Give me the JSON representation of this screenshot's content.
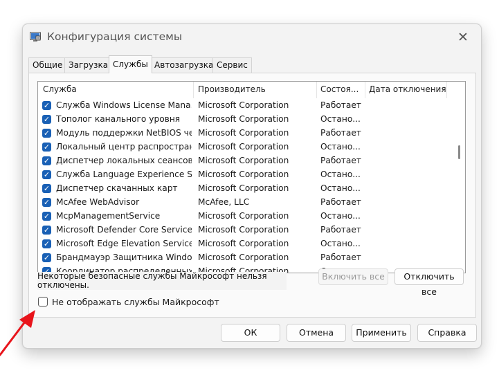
{
  "window": {
    "title": "Конфигурация системы",
    "close_icon": "close-icon"
  },
  "tabs": [
    {
      "label": "Общие"
    },
    {
      "label": "Загрузка"
    },
    {
      "label": "Службы"
    },
    {
      "label": "Автозагрузка"
    },
    {
      "label": "Сервис"
    }
  ],
  "active_tab": "Службы",
  "columns": {
    "service": "Служба",
    "manufacturer": "Производитель",
    "status": "Состоя...",
    "disabled_date": "Дата отключения"
  },
  "services": [
    {
      "name": "Служба Windows License Mana...",
      "manufacturer": "Microsoft Corporation",
      "status": "Работает",
      "checked": true
    },
    {
      "name": "Тополог канального уровня",
      "manufacturer": "Microsoft Corporation",
      "status": "Остано...",
      "checked": true
    },
    {
      "name": "Модуль поддержки NetBIOS че...",
      "manufacturer": "Microsoft Corporation",
      "status": "Работает",
      "checked": true
    },
    {
      "name": "Локальный центр распростран...",
      "manufacturer": "Microsoft Corporation",
      "status": "Остано...",
      "checked": true
    },
    {
      "name": "Диспетчер локальных сеансов",
      "manufacturer": "Microsoft Corporation",
      "status": "Работает",
      "checked": true
    },
    {
      "name": "Служба Language Experience S...",
      "manufacturer": "Microsoft Corporation",
      "status": "Остано...",
      "checked": true
    },
    {
      "name": "Диспетчер скачанных карт",
      "manufacturer": "Microsoft Corporation",
      "status": "Остано...",
      "checked": true
    },
    {
      "name": "McAfee WebAdvisor",
      "manufacturer": "McAfee, LLC",
      "status": "Работает",
      "checked": true
    },
    {
      "name": "McpManagementService",
      "manufacturer": "Microsoft Corporation",
      "status": "Остано...",
      "checked": true
    },
    {
      "name": "Microsoft Defender Core Service",
      "manufacturer": "Microsoft Corporation",
      "status": "Работает",
      "checked": true
    },
    {
      "name": "Microsoft Edge Elevation Service...",
      "manufacturer": "Microsoft Corporation",
      "status": "Остано...",
      "checked": true
    },
    {
      "name": "Брандмауэр Защитника Windows",
      "manufacturer": "Microsoft Corporation",
      "status": "Работает",
      "checked": true
    },
    {
      "name": "Координатор распределенных ...",
      "manufacturer": "Microsoft Corporation",
      "status": "Остано...",
      "checked": true
    }
  ],
  "note": {
    "line1": "Некоторые безопасные службы Майкрософт нельзя",
    "line2": "отключены."
  },
  "buttons": {
    "enable_all": "Включить все",
    "disable_all": "Отключить все",
    "ok": "ОК",
    "cancel": "Отмена",
    "apply": "Применить",
    "help": "Справка"
  },
  "hide_microsoft": {
    "label": "Не отображать службы Майкрософт",
    "checked": false
  },
  "colors": {
    "checkbox_accent": "#1960b5",
    "arrow": "#e8141b"
  }
}
